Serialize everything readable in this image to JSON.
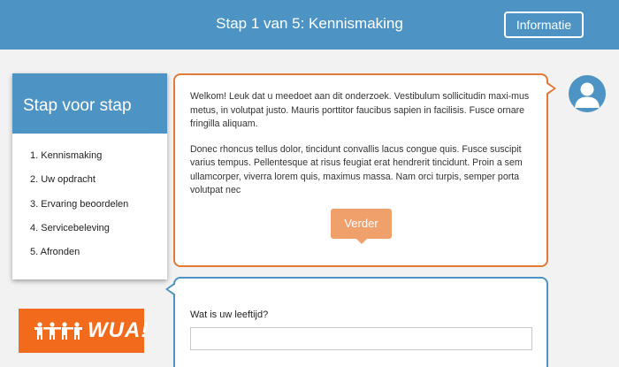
{
  "header": {
    "title": "Stap 1 van 5: Kennismaking",
    "info_button": "Informatie"
  },
  "sidebar": {
    "title": "Stap voor stap",
    "steps": [
      "1. Kennismaking",
      "2. Uw opdracht",
      "3. Ervaring beoordelen",
      "4. Servicebeleving",
      "5. Afronden"
    ]
  },
  "logo": {
    "text": "WUA!"
  },
  "message": {
    "paragraphs": [
      "Welkom! Leuk dat u meedoet aan dit onderzoek. Vestibulum sollicitudin maxi-mus metus, in volutpat justo. Mauris porttitor faucibus sapien in facilisis. Fusce ornare fringilla aliquam.",
      "Donec rhoncus tellus dolor, tincidunt convallis lacus congue quis. Fusce suscipit varius tempus. Pellentesque at risus feugiat erat hendrerit tincidunt. Proin a sem ullamcorper, viverra lorem quis, maximus massa. Nam orci turpis, semper porta volutpat nec"
    ],
    "next_button": "Verder"
  },
  "question": {
    "label": "Wat is uw leeftijd?",
    "value": "",
    "placeholder": ""
  },
  "icons": {
    "avatar": "user-avatar-icon",
    "logo": "wua-people-icon"
  },
  "colors": {
    "primary": "#4d94c4",
    "accent": "#e07a34",
    "button": "#f0a06b",
    "logo_bg": "#f26b1d"
  }
}
